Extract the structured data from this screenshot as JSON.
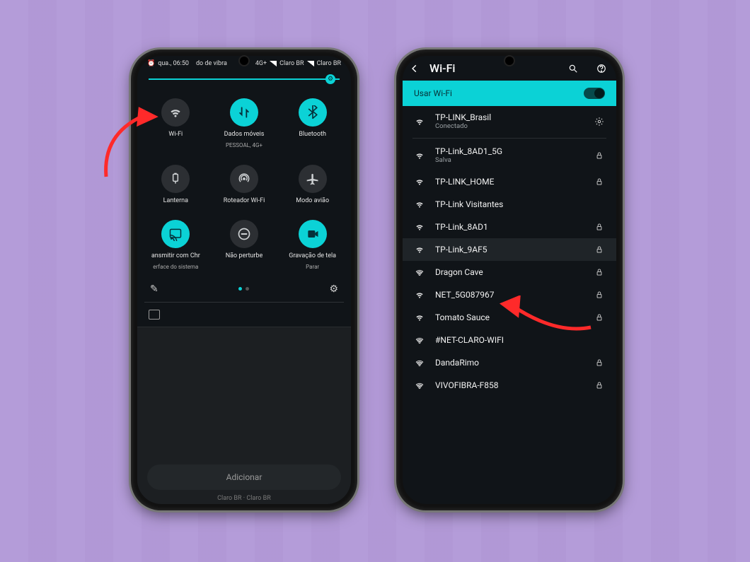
{
  "statusbar": {
    "clock_icon": "⏰",
    "day_time": "qua., 06:50",
    "ringer": "do de vibra",
    "net_badge": "4G+",
    "carrier1": "Claro BR",
    "carrier2": "Claro BR"
  },
  "brightness": {
    "gear": "⚙"
  },
  "tiles": [
    {
      "name": "wifi",
      "icon": "wifi",
      "state": "off",
      "label": "Wi-Fi",
      "sub": ""
    },
    {
      "name": "data",
      "icon": "data",
      "state": "on",
      "label": "Dados móveis",
      "sub": "PESSOAL, 4G+"
    },
    {
      "name": "bluetooth",
      "icon": "bluetooth",
      "state": "on",
      "label": "Bluetooth",
      "sub": ""
    },
    {
      "name": "flashlight",
      "icon": "flash",
      "state": "off",
      "label": "Lanterna",
      "sub": ""
    },
    {
      "name": "hotspot",
      "icon": "hotspot",
      "state": "off",
      "label": "Roteador Wi-Fi",
      "sub": ""
    },
    {
      "name": "airplane",
      "icon": "airplane",
      "state": "off",
      "label": "Modo avião",
      "sub": ""
    },
    {
      "name": "cast",
      "icon": "cast",
      "state": "on",
      "label": "ansmitir com Chr",
      "sub": "erface do sistema"
    },
    {
      "name": "dnd",
      "icon": "dnd",
      "state": "off",
      "label": "Não perturbe",
      "sub": ""
    },
    {
      "name": "record",
      "icon": "record",
      "state": "on",
      "label": "Gravação de tela",
      "sub": "Parar"
    }
  ],
  "qs_footer": {
    "edit": "✎",
    "gear": "⚙"
  },
  "notif": {
    "add_button": "Adicionar",
    "below": "Claro BR · Claro BR"
  },
  "wifi_screen": {
    "title": "Wi-Fi",
    "use_wifi": "Usar Wi-Fi",
    "networks": [
      {
        "name": "TP-LINK_Brasil",
        "sub": "Conectado",
        "tail": "gear",
        "strength": "full",
        "highlight": false
      },
      {
        "name": "TP-Link_8AD1_5G",
        "sub": "Salva",
        "tail": "lock",
        "strength": "full",
        "highlight": false
      },
      {
        "name": "TP-LINK_HOME",
        "sub": "",
        "tail": "lock",
        "strength": "full",
        "highlight": false
      },
      {
        "name": "TP-Link Visitantes",
        "sub": "",
        "tail": "",
        "strength": "full",
        "highlight": false
      },
      {
        "name": "TP-Link_8AD1",
        "sub": "",
        "tail": "lock",
        "strength": "full",
        "highlight": false
      },
      {
        "name": "TP-Link_9AF5",
        "sub": "",
        "tail": "lock",
        "strength": "full",
        "highlight": true
      },
      {
        "name": "Dragon Cave",
        "sub": "",
        "tail": "lock",
        "strength": "outline",
        "highlight": false
      },
      {
        "name": "NET_5G087967",
        "sub": "",
        "tail": "lock",
        "strength": "full",
        "highlight": false
      },
      {
        "name": "Tomato Sauce",
        "sub": "",
        "tail": "lock",
        "strength": "full",
        "highlight": false
      },
      {
        "name": "#NET-CLARO-WIFI",
        "sub": "",
        "tail": "",
        "strength": "outline",
        "highlight": false
      },
      {
        "name": "DandaRimo",
        "sub": "",
        "tail": "lock",
        "strength": "outline",
        "highlight": false
      },
      {
        "name": "VIVOFIBRA-F858",
        "sub": "",
        "tail": "lock",
        "strength": "outline",
        "highlight": false
      }
    ]
  }
}
